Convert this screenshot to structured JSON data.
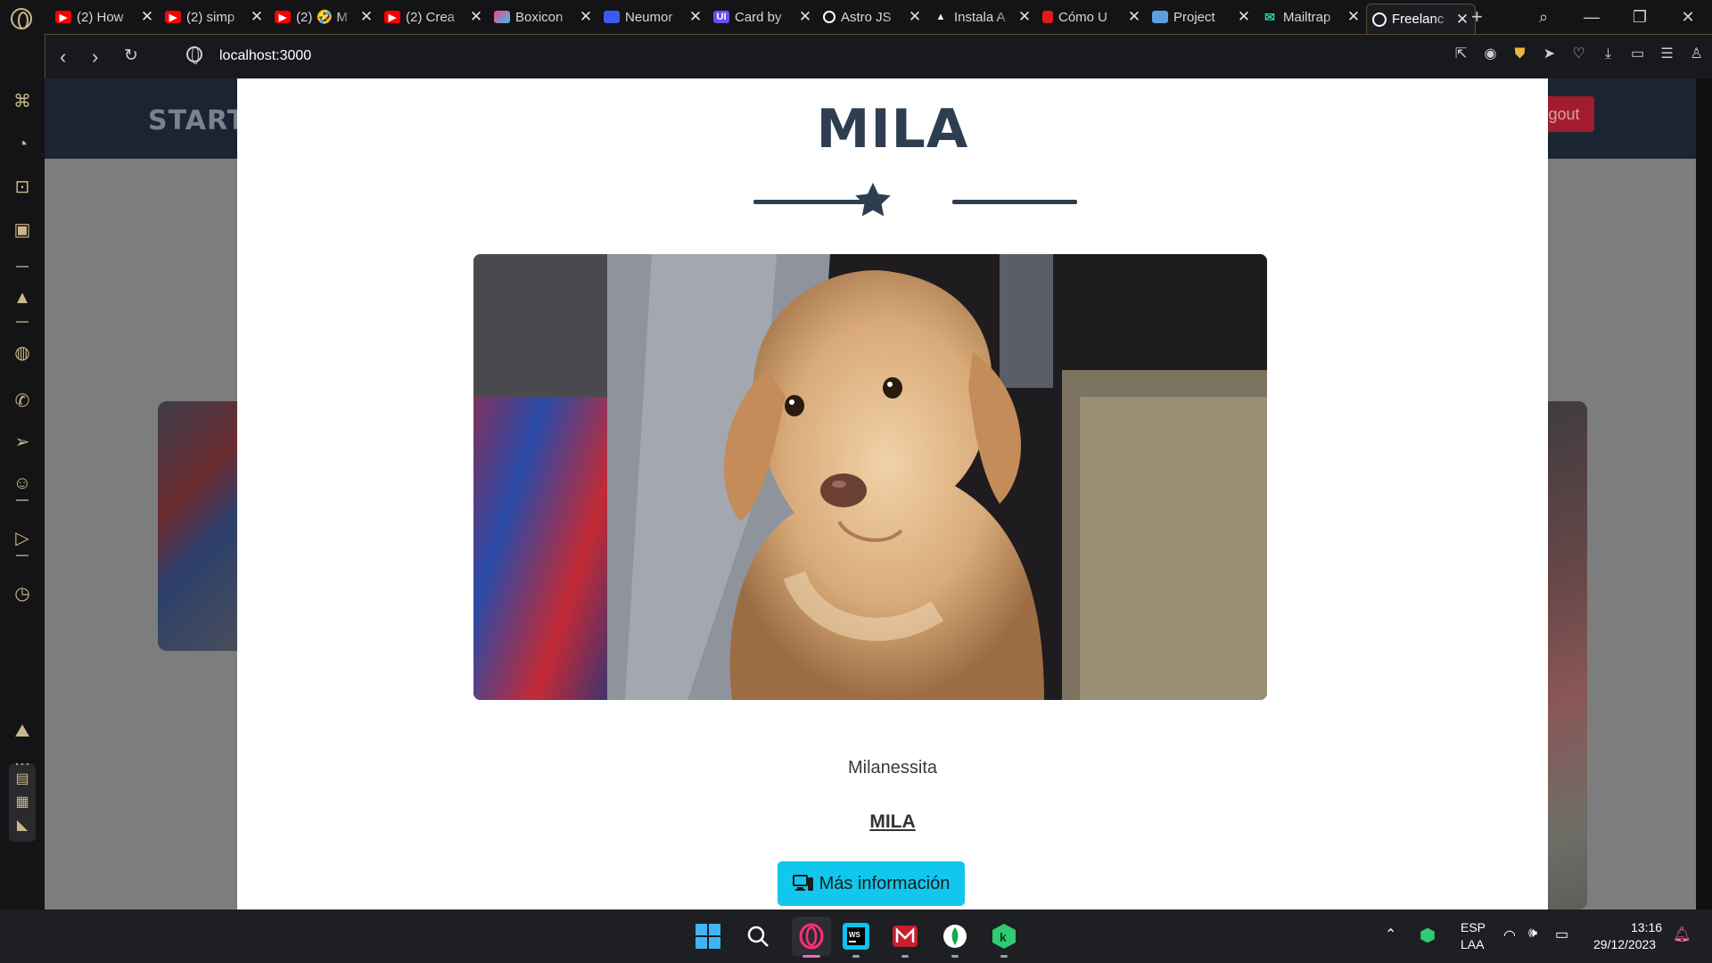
{
  "browser": {
    "tabs": [
      {
        "label": "(2) How",
        "icon": "youtube-icon",
        "color": "#ff0000"
      },
      {
        "label": "(2) simp",
        "icon": "youtube-icon",
        "color": "#ff0000"
      },
      {
        "label": "(2) 🤣 M",
        "icon": "youtube-icon",
        "color": "#ff0000"
      },
      {
        "label": "(2) Crea",
        "icon": "youtube-icon",
        "color": "#ff0000"
      },
      {
        "label": "Boxicon",
        "icon": "boxicons-icon",
        "color": "#ff3d8b"
      },
      {
        "label": "Neumor",
        "icon": "neumorphism-icon",
        "color": "#3a5af0"
      },
      {
        "label": "Card by",
        "icon": "uiverse-icon",
        "color": "#6f4cf5"
      },
      {
        "label": "Astro JS",
        "icon": "astro-icon",
        "color": "#ffffff"
      },
      {
        "label": "Instala A",
        "icon": "astro-logo-icon",
        "color": "#ffffff"
      },
      {
        "label": "Cómo U",
        "icon": "red-bookmark-icon",
        "color": "#e21a1a"
      },
      {
        "label": "Project",
        "icon": "monitor-icon",
        "color": "#5aa0e0"
      },
      {
        "label": "Mailtrap",
        "icon": "mailtrap-icon",
        "color": "#22d3a0"
      },
      {
        "label": "Freelanc",
        "icon": "globe-icon",
        "color": "#ffffff",
        "active": true
      }
    ],
    "url": "localhost:3000"
  },
  "site": {
    "brand": "START",
    "logout_label": "Logout"
  },
  "modal": {
    "title": "MILA",
    "photo_alt": "Mila puppy photo",
    "caption": "Milanessita",
    "name_link": "MILA",
    "button_label": "Más información",
    "button_icon": "desktop-icon"
  },
  "taskbar": {
    "lang": "ESP",
    "layout": "LAA",
    "time": "13:16",
    "date": "29/12/2023"
  },
  "colors": {
    "modal_title": "#2c3e50",
    "button_bg": "#11c7ee",
    "logout_bg": "#a11d2d",
    "navbar_bg": "#1b2531"
  }
}
